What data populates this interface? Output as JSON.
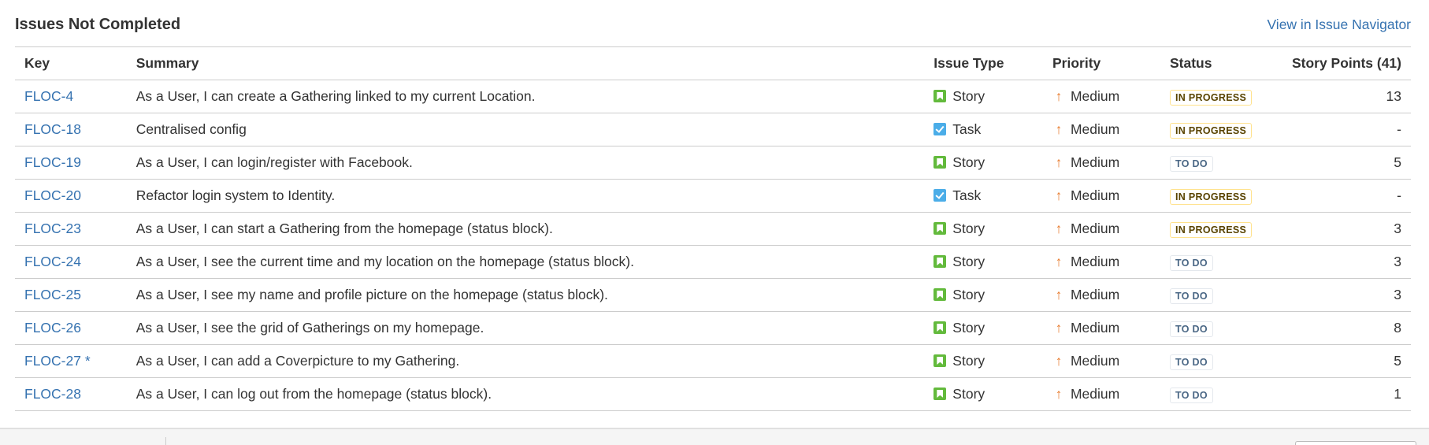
{
  "section": {
    "title": "Issues Not Completed",
    "navigator_link": "View in Issue Navigator"
  },
  "table": {
    "headers": {
      "key": "Key",
      "summary": "Summary",
      "issue_type": "Issue Type",
      "priority": "Priority",
      "status": "Status",
      "story_points": "Story Points (41)"
    },
    "rows": [
      {
        "key": "FLOC-4",
        "summary": "As a User, I can create a Gathering linked to my current Location.",
        "type": "Story",
        "type_icon": "story-icon",
        "priority": "Medium",
        "priority_icon": "arrow-up-icon",
        "status": "IN PROGRESS",
        "points": "13"
      },
      {
        "key": "FLOC-18",
        "summary": "Centralised config",
        "type": "Task",
        "type_icon": "task-icon",
        "priority": "Medium",
        "priority_icon": "arrow-up-icon",
        "status": "IN PROGRESS",
        "points": "-"
      },
      {
        "key": "FLOC-19",
        "summary": "As a User, I can login/register with Facebook.",
        "type": "Story",
        "type_icon": "story-icon",
        "priority": "Medium",
        "priority_icon": "arrow-up-icon",
        "status": "TO DO",
        "points": "5"
      },
      {
        "key": "FLOC-20",
        "summary": "Refactor login system to Identity.",
        "type": "Task",
        "type_icon": "task-icon",
        "priority": "Medium",
        "priority_icon": "arrow-up-icon",
        "status": "IN PROGRESS",
        "points": "-"
      },
      {
        "key": "FLOC-23",
        "summary": "As a User, I can start a Gathering from the homepage (status block).",
        "type": "Story",
        "type_icon": "story-icon",
        "priority": "Medium",
        "priority_icon": "arrow-up-icon",
        "status": "IN PROGRESS",
        "points": "3"
      },
      {
        "key": "FLOC-24",
        "summary": "As a User, I see the current time and my location on the homepage (status block).",
        "type": "Story",
        "type_icon": "story-icon",
        "priority": "Medium",
        "priority_icon": "arrow-up-icon",
        "status": "TO DO",
        "points": "3"
      },
      {
        "key": "FLOC-25",
        "summary": "As a User, I see my name and profile picture on the homepage (status block).",
        "type": "Story",
        "type_icon": "story-icon",
        "priority": "Medium",
        "priority_icon": "arrow-up-icon",
        "status": "TO DO",
        "points": "3"
      },
      {
        "key": "FLOC-26",
        "summary": "As a User, I see the grid of Gatherings on my homepage.",
        "type": "Story",
        "type_icon": "story-icon",
        "priority": "Medium",
        "priority_icon": "arrow-up-icon",
        "status": "TO DO",
        "points": "8"
      },
      {
        "key": "FLOC-27 *",
        "summary": "As a User, I can add a Coverpicture to my Gathering.",
        "type": "Story",
        "type_icon": "story-icon",
        "priority": "Medium",
        "priority_icon": "arrow-up-icon",
        "status": "TO DO",
        "points": "5"
      },
      {
        "key": "FLOC-28",
        "summary": "As a User, I can log out from the homepage (status block).",
        "type": "Story",
        "type_icon": "story-icon",
        "priority": "Medium",
        "priority_icon": "arrow-up-icon",
        "status": "TO DO",
        "points": "1"
      }
    ]
  },
  "colors": {
    "link": "#3572b0",
    "story": "#63ba3c",
    "task": "#4bade8",
    "priority_medium": "#e97f33",
    "in_progress_border": "#ffe28c",
    "in_progress_text": "#594300",
    "todo_border": "#e4e8ed",
    "todo_text": "#4a6785"
  }
}
